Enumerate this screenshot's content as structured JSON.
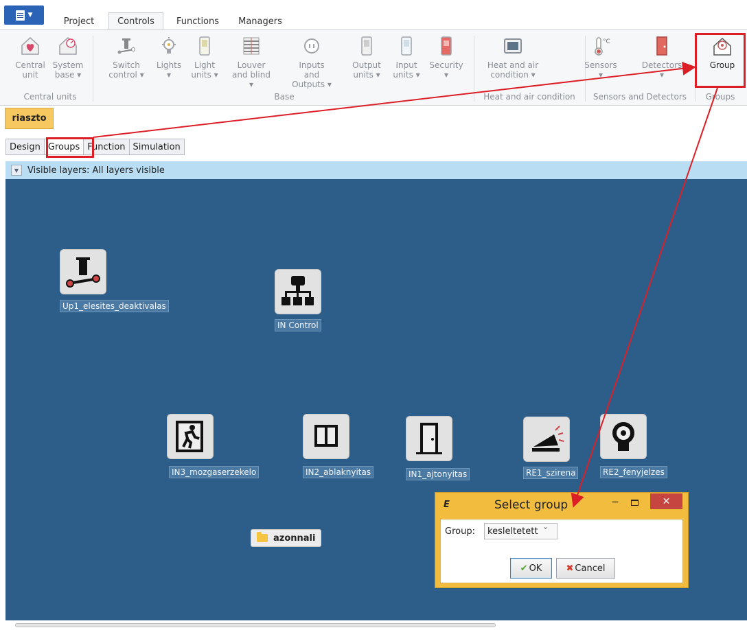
{
  "menu": {
    "tabs": [
      "Project",
      "Controls",
      "Functions",
      "Managers"
    ],
    "active_tab": "Controls"
  },
  "ribbon": {
    "buttons": [
      {
        "label": "Central\nunit",
        "icon": "heart-house-icon"
      },
      {
        "label": "System\nbase ▾",
        "icon": "gauge-house-icon"
      },
      {
        "label": "Switch\ncontrol ▾",
        "icon": "switch-icon"
      },
      {
        "label": "Lights\n▾",
        "icon": "bulb-icon"
      },
      {
        "label": "Light\nunits ▾",
        "icon": "light-unit-icon"
      },
      {
        "label": "Louver\nand blind ▾",
        "icon": "blind-icon"
      },
      {
        "label": "Inputs and\nOutputs ▾",
        "icon": "io-icon"
      },
      {
        "label": "Output\nunits ▾",
        "icon": "output-unit-icon"
      },
      {
        "label": "Input\nunits ▾",
        "icon": "input-unit-icon"
      },
      {
        "label": "Security\n▾",
        "icon": "security-icon"
      },
      {
        "label": "Heat and air\ncondition ▾",
        "icon": "hvac-icon"
      },
      {
        "label": "Sensors\n▾",
        "icon": "thermometer-icon"
      },
      {
        "label": "Detectors\n▾",
        "icon": "detector-icon"
      },
      {
        "label": "Group",
        "icon": "group-icon"
      }
    ],
    "groups": [
      "Central units",
      "Base",
      "Heat and air condition",
      "Sensors and Detectors",
      "Groups"
    ],
    "thermo_unit": "°C"
  },
  "project": {
    "name": "riaszto"
  },
  "subtabs": [
    "Design",
    "Groups",
    "Function",
    "Simulation"
  ],
  "active_subtab": "Groups",
  "layers": {
    "text": "Visible layers: All layers visible"
  },
  "canvas": {
    "nodes": [
      {
        "label": "Up1_elesites_deaktivalas",
        "icon": "switch-icon"
      },
      {
        "label": "IN Control",
        "icon": "network-icon"
      },
      {
        "label": "IN3_mozgaserzekelo",
        "icon": "exit-runner-icon"
      },
      {
        "label": "IN2_ablaknyitas",
        "icon": "window-icon"
      },
      {
        "label": "IN1_ajtonyitas",
        "icon": "door-icon"
      },
      {
        "label": "RE1_szirena",
        "icon": "siren-icon"
      },
      {
        "label": "RE2_fenyjelzes",
        "icon": "beacon-icon"
      }
    ],
    "folder": {
      "label": "azonnali",
      "icon": "folder-icon"
    }
  },
  "dialog": {
    "logo": "E",
    "title": "Select group",
    "group_label": "Group:",
    "group_value": "kesleltetett",
    "ok_label": "OK",
    "cancel_label": "Cancel",
    "close_glyph": "✕",
    "minimize_glyph": "‒",
    "dropdown_glyph": "˅",
    "ok_glyph": "✔",
    "cancel_glyph": "✖"
  },
  "colors": {
    "canvas": "#2c5e89",
    "highlight": "#dc1f26",
    "dialog": "#f2bd3f",
    "chip": "#f8c860",
    "layerbar": "#b9ddf3"
  }
}
